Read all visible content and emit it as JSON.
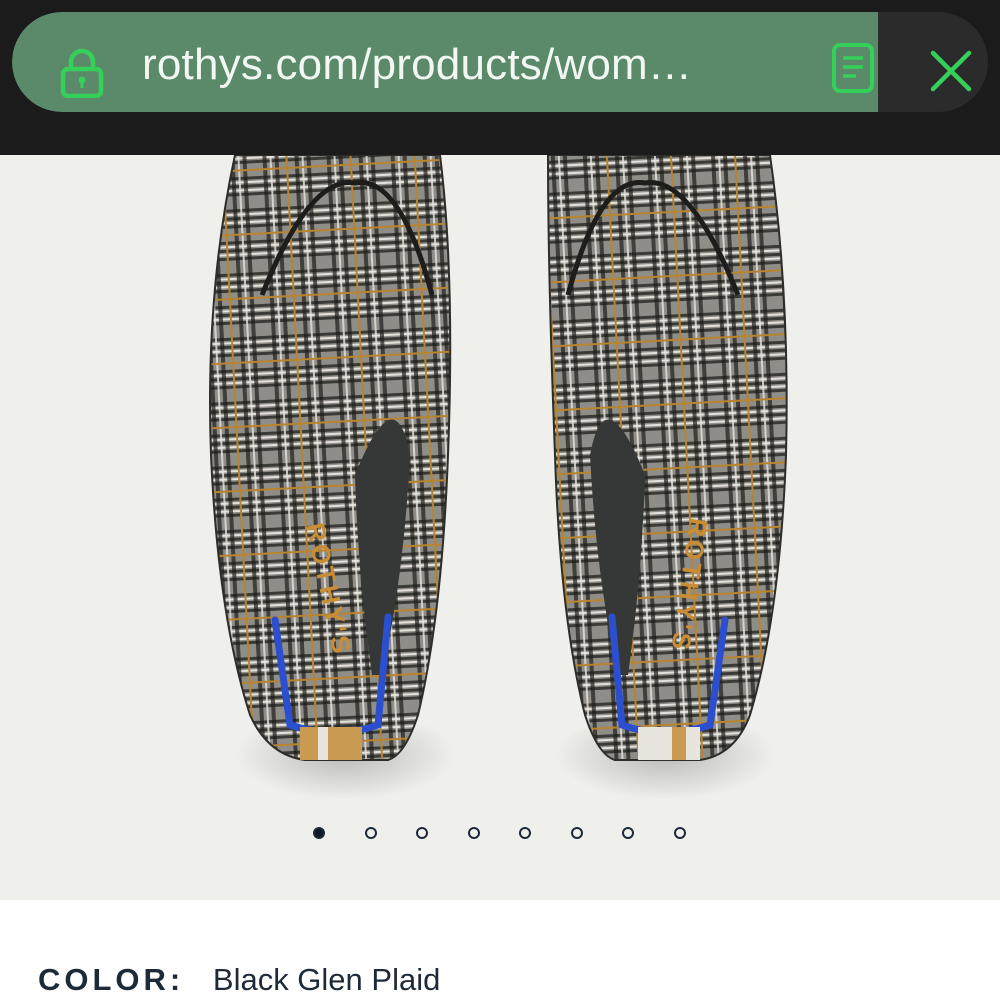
{
  "browser": {
    "url": "rothys.com/products/wom…",
    "icons": {
      "lock": "lock-icon",
      "reader": "reader-mode-icon",
      "close": "close-icon"
    },
    "colors": {
      "url_field": "#5b8a6a",
      "icon_green": "#35d05a",
      "bar": "#1a1b1a"
    }
  },
  "product": {
    "brand_mark": "ROTHY'S",
    "image_dots_count": 8,
    "active_image_index": 0,
    "color_label": "COLOR:",
    "color_value": "Black Glen Plaid",
    "colors": {
      "heel_stripe": "#2b4fcf",
      "plaid_accent": "#b8842f",
      "knit_dark": "#3a3a36",
      "knit_light": "#d9d6cf"
    }
  }
}
